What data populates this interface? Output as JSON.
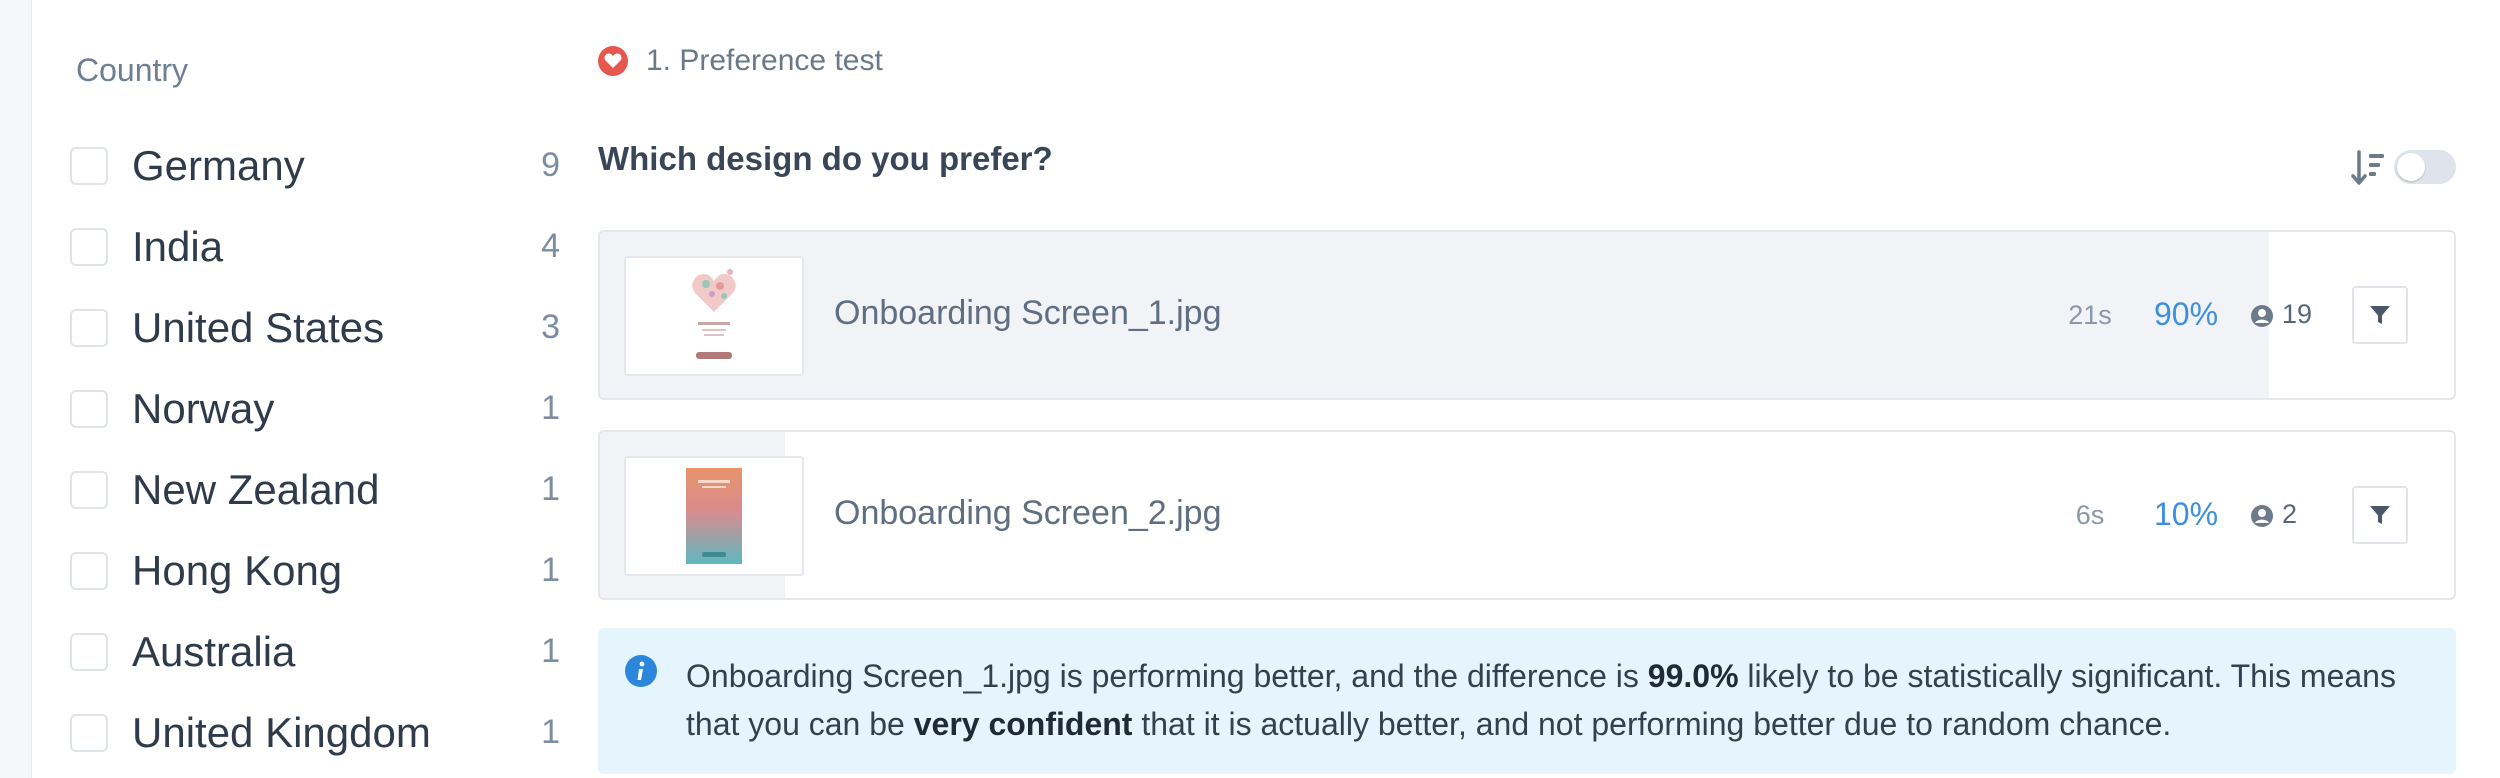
{
  "sidebar": {
    "title": "Country",
    "countries": [
      {
        "name": "Germany",
        "count": "9"
      },
      {
        "name": "India",
        "count": "4"
      },
      {
        "name": "United States",
        "count": "3"
      },
      {
        "name": "Norway",
        "count": "1"
      },
      {
        "name": "New Zealand",
        "count": "1"
      },
      {
        "name": "Hong Kong",
        "count": "1"
      },
      {
        "name": "Australia",
        "count": "1"
      },
      {
        "name": "United Kingdom",
        "count": "1"
      }
    ]
  },
  "test": {
    "label": "1. Preference test",
    "icon": "heart-icon",
    "question": "Which design do you prefer?",
    "options": [
      {
        "name": "Onboarding Screen_1.jpg",
        "time": "21s",
        "percent": "90%",
        "share": 0.9,
        "votes": "19"
      },
      {
        "name": "Onboarding Screen_2.jpg",
        "time": "6s",
        "percent": "10%",
        "share": 0.1,
        "votes": "2"
      }
    ]
  },
  "info": {
    "part1": "Onboarding Screen_1.jpg is performing better, and the difference is ",
    "significance": "99.0%",
    "part2": " likely to be statistically significant. This means that you can be ",
    "confidence": "very confident",
    "part3": " that it is actually better, and not performing better due to random chance."
  },
  "colors": {
    "accent": "#3d8fe0",
    "heart": "#e5574f",
    "info_bg": "#e6f4fd"
  }
}
